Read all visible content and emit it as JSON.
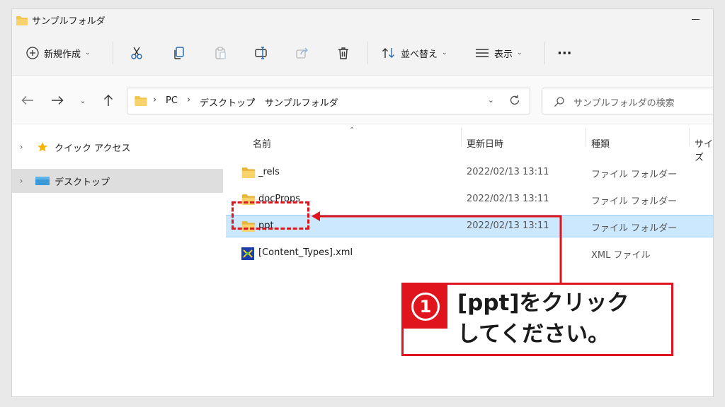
{
  "window": {
    "title": "サンプルフォルダ"
  },
  "toolbar": {
    "new_label": "新規作成",
    "sort_label": "並べ替え",
    "view_label": "表示",
    "more_label": "···"
  },
  "address": {
    "crumbs": [
      "PC",
      "デスクトップ",
      "サンプルフォルダ"
    ],
    "search_placeholder": "サンプルフォルダの検索"
  },
  "navpane": {
    "items": [
      {
        "label": "クイック アクセス"
      },
      {
        "label": "デスクトップ"
      }
    ]
  },
  "filelist": {
    "columns": {
      "name": "名前",
      "date": "更新日時",
      "type": "種類",
      "size": "サイズ"
    },
    "rows": [
      {
        "name": "_rels",
        "date": "2022/02/13 13:11",
        "type": "ファイル フォルダー"
      },
      {
        "name": "docProps",
        "date": "2022/02/13 13:11",
        "type": "ファイル フォルダー"
      },
      {
        "name": "ppt",
        "date": "2022/02/13 13:11",
        "type": "ファイル フォルダー"
      },
      {
        "name": "[Content_Types].xml",
        "date": "",
        "type": "XML ファイル"
      }
    ]
  },
  "annotation": {
    "number": "1",
    "line1": "[ppt]をクリック",
    "line2": "してください。",
    "color": "#e0141c"
  },
  "colors": {
    "selection": "#cce8ff",
    "folder": "#f4c34a",
    "accent": "#e0141c"
  }
}
